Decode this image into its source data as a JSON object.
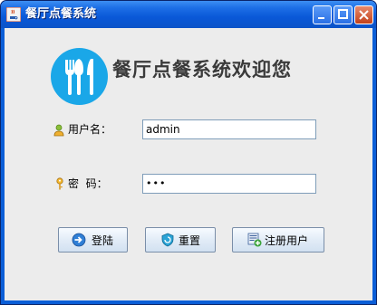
{
  "window": {
    "title": "餐厅点餐系统"
  },
  "heading": "餐厅点餐系统欢迎您",
  "username": {
    "label": "用户名：",
    "value": "admin"
  },
  "password": {
    "label": "密  码：",
    "masked_value": "•••"
  },
  "buttons": {
    "login": "登陆",
    "reset": "重置",
    "register": "注册用户"
  },
  "icons": {
    "app": "java-cup-icon",
    "logo": "fork-knife-logo-icon",
    "user": "user-icon",
    "key": "key-icon",
    "login": "login-arrow-icon",
    "reset": "reset-shield-icon",
    "register": "register-user-icon"
  },
  "colors": {
    "logo_blue": "#1aa7e8",
    "titlebar_blue": "#0b5ed7",
    "panel_gray": "#ececec"
  }
}
